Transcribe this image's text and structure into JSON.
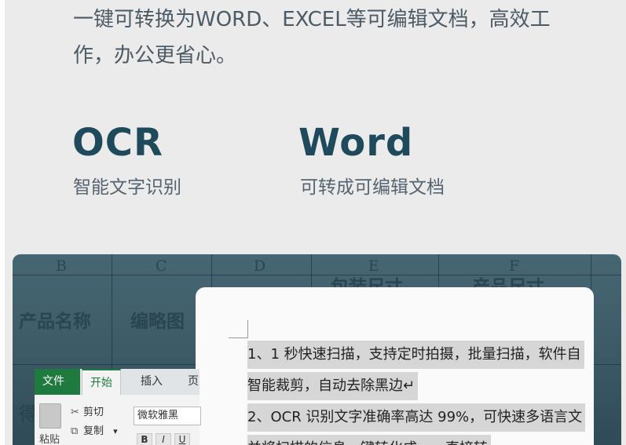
{
  "intro": {
    "line1": "一键可转换为WORD、EXCEL等可编辑文档，高效工",
    "line2": "作，办公更省心。"
  },
  "features": [
    {
      "title": "OCR",
      "subtitle": "智能文字识别"
    },
    {
      "title": "Word",
      "subtitle": "可转成可编辑文档"
    }
  ],
  "spreadsheet": {
    "columns": [
      "B",
      "C",
      "D",
      "E",
      "F"
    ],
    "cells": {
      "product_name": "产品名称",
      "thumbnail": "编略图",
      "partial_e": "包装尺寸",
      "partial_f": "产品尺寸",
      "left_char": "得"
    }
  },
  "document": {
    "lines": [
      "1、1 秒快速扫描，支持定时拍摄，批量扫描，软件自",
      "智能裁剪，自动去除黑边↵",
      "2、OCR 识别文字准确率高达 99%，可快速多语言文",
      "并将扫描的信息一键转化成……直接转"
    ]
  },
  "ribbon": {
    "tabs": {
      "file": "文件",
      "home": "开始",
      "insert": "插入",
      "more": "页"
    },
    "paste": "粘贴",
    "cut": "剪切",
    "copy": "复制",
    "copy_arrow": "▾",
    "font": "微软雅黑",
    "bold": "B",
    "italic": "I",
    "underline": "U"
  },
  "icons": {
    "cut": "scissors-icon",
    "copy": "copy-icon",
    "paste": "clipboard-icon"
  }
}
